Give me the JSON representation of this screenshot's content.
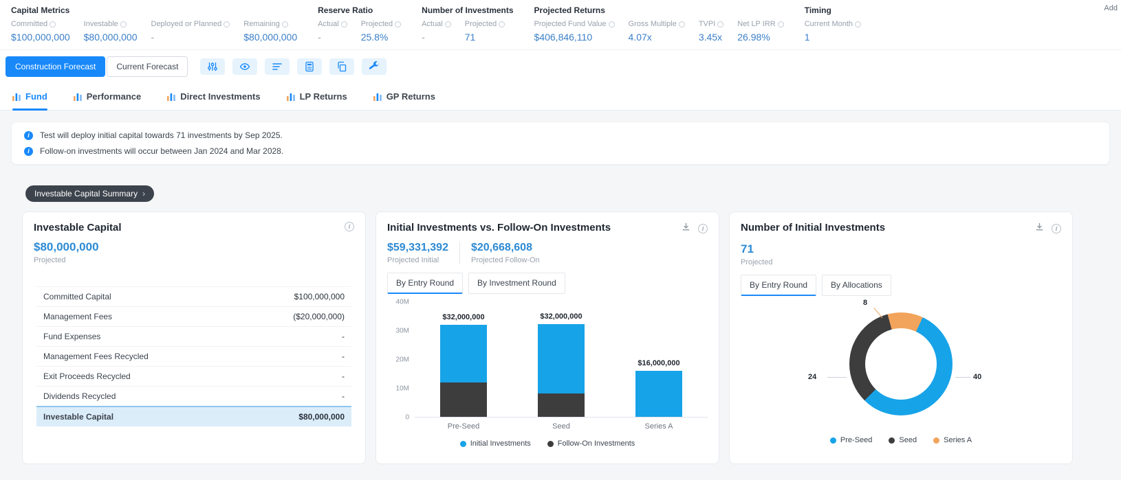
{
  "colors": {
    "accent": "#1989fa",
    "chart_blue": "#17a3e8",
    "chart_dark": "#3d3d3d",
    "chart_orange": "#f2a45c",
    "value_blue": "#2d8ad3"
  },
  "header": {
    "add_label": "Add",
    "groups": [
      {
        "title": "Capital Metrics",
        "metrics": [
          {
            "label": "Committed",
            "value": "$100,000,000"
          },
          {
            "label": "Investable",
            "value": "$80,000,000"
          },
          {
            "label": "Deployed or Planned",
            "value": "-"
          },
          {
            "label": "Remaining",
            "value": "$80,000,000"
          }
        ]
      },
      {
        "title": "Reserve Ratio",
        "metrics": [
          {
            "label": "Actual",
            "value": "-"
          },
          {
            "label": "Projected",
            "value": "25.8%"
          }
        ]
      },
      {
        "title": "Number of Investments",
        "metrics": [
          {
            "label": "Actual",
            "value": "-"
          },
          {
            "label": "Projected",
            "value": "71"
          }
        ]
      },
      {
        "title": "Projected Returns",
        "metrics": [
          {
            "label": "Projected Fund Value",
            "value": "$406,846,110"
          },
          {
            "label": "Gross Multiple",
            "value": "4.07x"
          },
          {
            "label": "TVPI",
            "value": "3.45x"
          },
          {
            "label": "Net LP IRR",
            "value": "26.98%"
          }
        ]
      },
      {
        "title": "Timing",
        "metrics": [
          {
            "label": "Current Month",
            "value": "1"
          }
        ]
      }
    ]
  },
  "toolbar": {
    "primary_button": "Construction Forecast",
    "secondary_button": "Current Forecast",
    "icons": [
      "sliders-icon",
      "eye-icon",
      "list-icon",
      "calculator-icon",
      "copy-icon",
      "wrench-icon"
    ]
  },
  "tabs": [
    {
      "label": "Fund",
      "active": true
    },
    {
      "label": "Performance",
      "active": false
    },
    {
      "label": "Direct Investments",
      "active": false
    },
    {
      "label": "LP Returns",
      "active": false
    },
    {
      "label": "GP Returns",
      "active": false
    }
  ],
  "notices": [
    "Test will deploy initial capital towards 71 investments by Sep 2025.",
    "Follow-on investments will occur between Jan 2024 and Mar 2028."
  ],
  "section_pill": {
    "label": "Investable Capital Summary"
  },
  "cards": {
    "investable_capital": {
      "title": "Investable Capital",
      "value": "$80,000,000",
      "caption": "Projected",
      "rows": [
        {
          "label": "Committed Capital",
          "value": "$100,000,000",
          "highlight": false
        },
        {
          "label": "Management Fees",
          "value": "($20,000,000)",
          "highlight": false
        },
        {
          "label": "Fund Expenses",
          "value": "-",
          "highlight": false
        },
        {
          "label": "Management Fees Recycled",
          "value": "-",
          "highlight": false
        },
        {
          "label": "Exit Proceeds Recycled",
          "value": "-",
          "highlight": false
        },
        {
          "label": "Dividends Recycled",
          "value": "-",
          "highlight": false
        },
        {
          "label": "Investable Capital",
          "value": "$80,000,000",
          "highlight": true
        }
      ]
    },
    "initial_vs_followon": {
      "title": "Initial Investments vs. Follow-On Investments",
      "stats": [
        {
          "value": "$59,331,392",
          "caption": "Projected Initial"
        },
        {
          "value": "$20,668,608",
          "caption": "Projected Follow-On"
        }
      ],
      "tabs": [
        {
          "label": "By Entry Round",
          "active": true
        },
        {
          "label": "By Investment Round",
          "active": false
        }
      ]
    },
    "number_of_initial": {
      "title": "Number of Initial Investments",
      "value": "71",
      "caption": "Projected",
      "tabs": [
        {
          "label": "By Entry Round",
          "active": true
        },
        {
          "label": "By Allocations",
          "active": false
        }
      ]
    }
  },
  "chart_data": [
    {
      "type": "bar",
      "stacked": true,
      "title": "Initial Investments vs. Follow-On Investments",
      "categories": [
        "Pre-Seed",
        "Seed",
        "Series A"
      ],
      "series": [
        {
          "name": "Initial Investments",
          "color": "#17a3e8",
          "values": [
            20000000,
            24000000,
            16000000
          ]
        },
        {
          "name": "Follow-On Investments",
          "color": "#3d3d3d",
          "values": [
            12000000,
            8000000,
            0
          ]
        }
      ],
      "total_labels": [
        "$32,000,000",
        "$32,000,000",
        "$16,000,000"
      ],
      "ylim": [
        0,
        40000000
      ],
      "yticks": [
        {
          "value": 0,
          "label": "0"
        },
        {
          "value": 10000000,
          "label": "10M"
        },
        {
          "value": 20000000,
          "label": "20M"
        },
        {
          "value": 30000000,
          "label": "30M"
        },
        {
          "value": 40000000,
          "label": "40M"
        }
      ],
      "legend_position": "bottom"
    },
    {
      "type": "pie",
      "donut": true,
      "title": "Number of Initial Investments",
      "labels": [
        "Pre-Seed",
        "Seed",
        "Series A"
      ],
      "values": [
        40,
        24,
        8
      ],
      "colors": [
        "#17a3e8",
        "#3d3d3d",
        "#f2a45c"
      ],
      "callout_positions": [
        "right",
        "left",
        "top"
      ],
      "start_angle_deg": -15,
      "legend_position": "bottom"
    }
  ]
}
